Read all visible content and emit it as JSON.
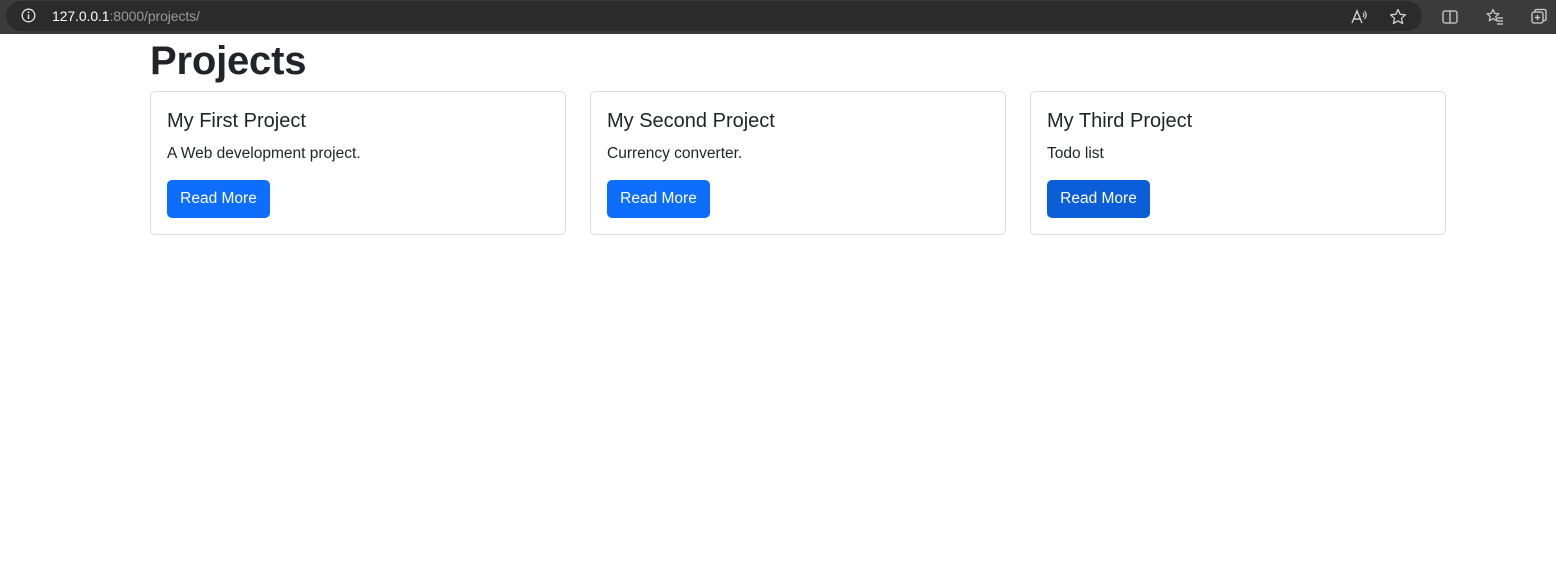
{
  "browser": {
    "url_host": "127.0.0.1",
    "url_rest": ":8000/projects/",
    "icons": [
      "info-icon",
      "read-aloud-icon",
      "favorite-star-icon",
      "split-screen-icon",
      "favorites-list-icon",
      "collections-icon"
    ]
  },
  "page": {
    "title": "Projects"
  },
  "projects": [
    {
      "title": "My First Project",
      "description": "A Web development project.",
      "button_label": "Read More"
    },
    {
      "title": "My Second Project",
      "description": "Currency converter.",
      "button_label": "Read More"
    },
    {
      "title": "My Third Project",
      "description": "Todo list",
      "button_label": "Read More"
    }
  ],
  "colors": {
    "button_primary": "#0d6efd",
    "button_hover": "#0b5ed7",
    "text": "#212529",
    "card_border": "#dcdcdc",
    "browser_bar": "#3b3b3b"
  }
}
